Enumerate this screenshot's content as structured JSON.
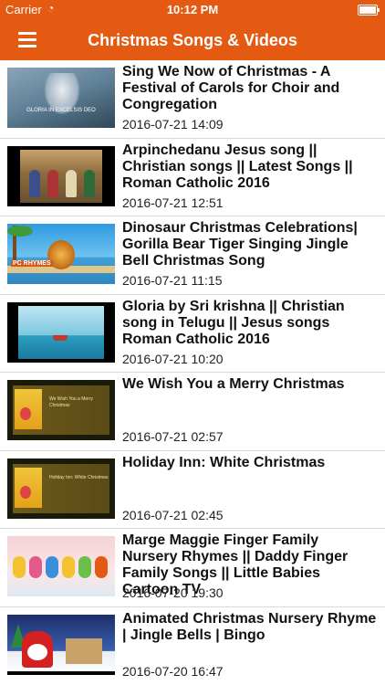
{
  "status_bar": {
    "carrier": "Carrier",
    "time": "10:12 PM"
  },
  "nav": {
    "title": "Christmas Songs & Videos",
    "menu_icon": "hamburger-menu-icon"
  },
  "videos": [
    {
      "title": "Sing We Now of Christmas - A Festival of Carols for Choir and Congregation",
      "date": "2016-07-21 14:09",
      "thumb_caption": "GLORIA IN EXCELSIS DEO"
    },
    {
      "title": "Arpinchedanu Jesus song || Christian songs || Latest Songs || Roman Catholic 2016",
      "date": "2016-07-21 12:51"
    },
    {
      "title": "Dinosaur Christmas Celebrations| Gorilla Bear Tiger Singing Jingle Bell Christmas Song",
      "date": "2016-07-21 11:15",
      "thumb_caption": "PC RHYMES"
    },
    {
      "title": "Gloria by Sri krishna || Christian song in Telugu || Jesus songs Roman Catholic 2016",
      "date": "2016-07-21 10:20"
    },
    {
      "title": "We Wish You a Merry Christmas",
      "date": "2016-07-21 02:57",
      "thumb_caption": "We Wish You a Merry Christmas"
    },
    {
      "title": "Holiday Inn: White Christmas",
      "date": "2016-07-21 02:45",
      "thumb_caption": "Holiday Inn: White Christmas"
    },
    {
      "title": "Marge Maggie Finger Family Nursery Rhymes || Daddy Finger Family Songs || Little Babies Cartoon TV",
      "date": "2016-07-20 19:30"
    },
    {
      "title": "Animated Christmas Nursery Rhyme | Jingle Bells | Bingo",
      "date": "2016-07-20 16:47"
    }
  ],
  "colors": {
    "accent": "#e45a12",
    "text": "#111111",
    "separator": "#d9d9d9"
  }
}
